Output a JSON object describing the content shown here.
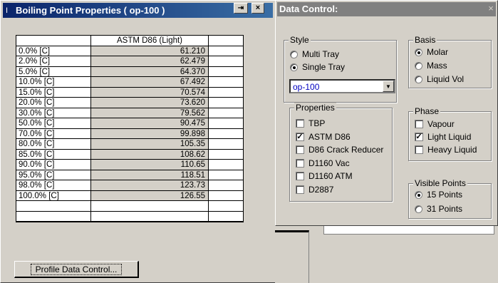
{
  "bp_window": {
    "title": "Boiling Point Properties ( op-100 )",
    "title_icon": "I",
    "pin_button": "pin-icon",
    "close_glyph": "×",
    "column_header": "ASTM D86 (Light)",
    "rows": [
      {
        "label": "0.0% [C]",
        "value": "61.210"
      },
      {
        "label": "2.0% [C]",
        "value": "62.479"
      },
      {
        "label": "5.0% [C]",
        "value": "64.370"
      },
      {
        "label": "10.0% [C]",
        "value": "67.492"
      },
      {
        "label": "15.0% [C]",
        "value": "70.574"
      },
      {
        "label": "20.0% [C]",
        "value": "73.620"
      },
      {
        "label": "30.0% [C]",
        "value": "79.562"
      },
      {
        "label": "50.0% [C]",
        "value": "90.475"
      },
      {
        "label": "70.0% [C]",
        "value": "99.898"
      },
      {
        "label": "80.0% [C]",
        "value": "105.35"
      },
      {
        "label": "85.0% [C]",
        "value": "108.62"
      },
      {
        "label": "90.0% [C]",
        "value": "110.65"
      },
      {
        "label": "95.0% [C]",
        "value": "118.51"
      },
      {
        "label": "98.0% [C]",
        "value": "123.73"
      },
      {
        "label": "100.0% [C]",
        "value": "126.55"
      }
    ],
    "profile_button": "Profile Data Control..."
  },
  "dc_window": {
    "title": "Data Control:",
    "close_glyph": "×",
    "style": {
      "legend": "Style",
      "multi_tray": "Multi Tray",
      "single_tray": "Single Tray",
      "selected": "single_tray"
    },
    "stream_select": {
      "value": "op-100"
    },
    "properties": {
      "legend": "Properties",
      "items": [
        {
          "label": "TBP",
          "checked": false
        },
        {
          "label": "ASTM D86",
          "checked": true
        },
        {
          "label": "D86 Crack Reducer",
          "checked": false
        },
        {
          "label": "D1160 Vac",
          "checked": false
        },
        {
          "label": "D1160 ATM",
          "checked": false
        },
        {
          "label": "D2887",
          "checked": false
        }
      ]
    },
    "basis": {
      "legend": "Basis",
      "items": [
        "Molar",
        "Mass",
        "Liquid Vol"
      ],
      "selected": 0
    },
    "phase": {
      "legend": "Phase",
      "items": [
        {
          "label": "Vapour",
          "checked": false
        },
        {
          "label": "Light Liquid",
          "checked": true
        },
        {
          "label": "Heavy Liquid",
          "checked": false
        }
      ]
    },
    "visible_points": {
      "legend": "Visible Points",
      "items": [
        "15 Points",
        "31 Points"
      ],
      "selected": 0
    }
  },
  "colors": {
    "titlebar_active": "#0a246a",
    "titlebar_inactive": "#808080",
    "face": "#d4d0c8"
  }
}
